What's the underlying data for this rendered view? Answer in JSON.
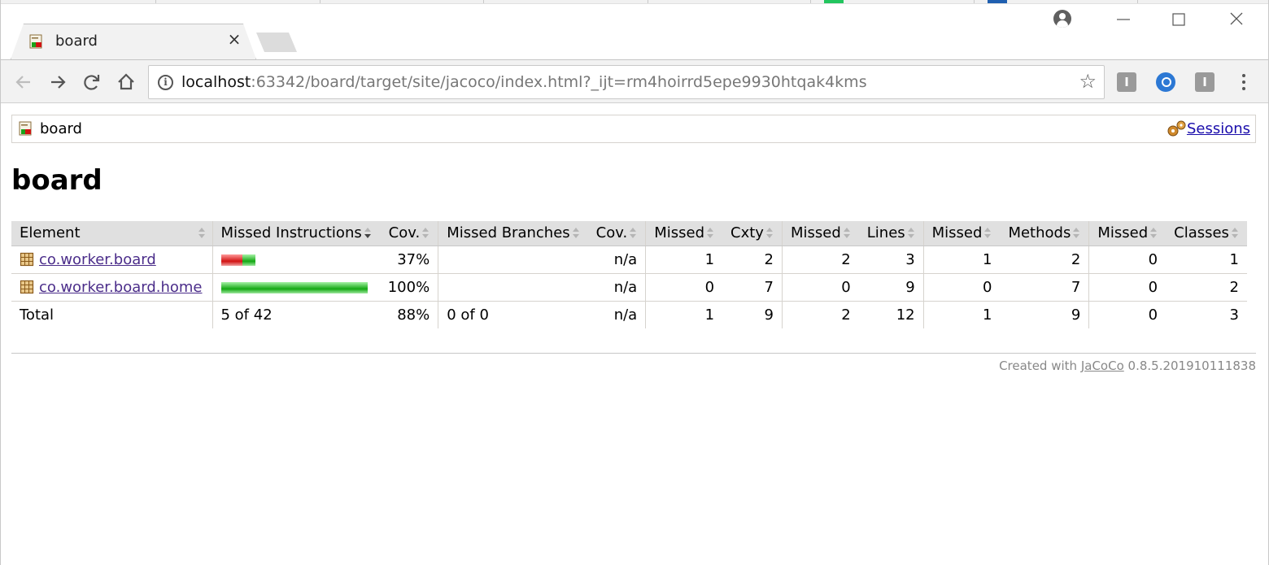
{
  "browser": {
    "tab_title": "board",
    "tab_close": "×",
    "url_host": "localhost",
    "url_rest": ":63342/board/target/site/jacoco/index.html?_ijt=rm4hoirrd5epe9930htqak4kms",
    "star": "☆",
    "info": "i",
    "ext1_label": "I",
    "ext3_label": "I",
    "minimize": "—",
    "maximize": "☐",
    "close": "✕"
  },
  "breadcrumb": {
    "label": "board",
    "sessions": "Sessions"
  },
  "page": {
    "title": "board"
  },
  "table": {
    "headers": {
      "element": "Element",
      "missed_instructions": "Missed Instructions",
      "cov1": "Cov.",
      "missed_branches": "Missed Branches",
      "cov2": "Cov.",
      "missed_cxty": "Missed",
      "cxty": "Cxty",
      "missed_lines": "Missed",
      "lines": "Lines",
      "missed_methods": "Missed",
      "methods": "Methods",
      "missed_classes": "Missed",
      "classes": "Classes"
    },
    "rows": [
      {
        "element": "co.worker.board",
        "missed_fraction": 0.63,
        "covered_fraction": 0.37,
        "cov1": "37%",
        "cov2": "n/a",
        "missed_cxty": "1",
        "cxty": "2",
        "missed_lines": "2",
        "lines": "3",
        "missed_methods": "1",
        "methods": "2",
        "missed_classes": "0",
        "classes": "1"
      },
      {
        "element": "co.worker.board.home",
        "missed_fraction": 0.0,
        "covered_fraction": 1.0,
        "cov1": "100%",
        "cov2": "n/a",
        "missed_cxty": "0",
        "cxty": "7",
        "missed_lines": "0",
        "lines": "9",
        "missed_methods": "0",
        "methods": "7",
        "missed_classes": "0",
        "classes": "2"
      }
    ],
    "total": {
      "label": "Total",
      "missed_instructions": "5 of 42",
      "cov1": "88%",
      "missed_branches": "0 of 0",
      "cov2": "n/a",
      "missed_cxty": "1",
      "cxty": "9",
      "missed_lines": "2",
      "lines": "12",
      "missed_methods": "1",
      "methods": "9",
      "missed_classes": "0",
      "classes": "3"
    }
  },
  "footer": {
    "prefix": "Created with",
    "link": "JaCoCo",
    "version": "0.8.5.201910111838"
  },
  "colors": {
    "missed_bar": "#d11212",
    "covered_bar": "#13a813",
    "link_visited": "#4b2d8a",
    "link": "#1a0dab"
  }
}
